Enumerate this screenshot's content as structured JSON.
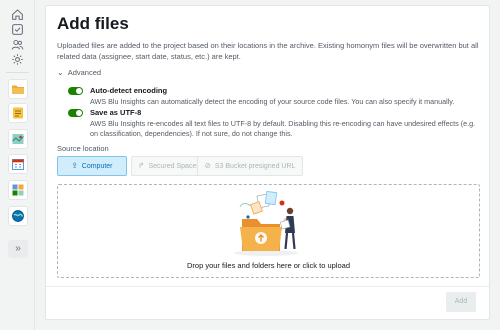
{
  "rail": {
    "icons": [
      "home-icon",
      "checklist-icon",
      "users-icon",
      "gear-icon"
    ],
    "apps": [
      "folder-app-icon",
      "notes-app-icon",
      "map-app-icon",
      "calendar-app-icon",
      "puzzle-app-icon",
      "globe-app-icon"
    ],
    "expand_label": "»"
  },
  "page": {
    "title": "Add files",
    "description": "Uploaded files are added to the project based on their locations in the archive. Existing homonym files will be overwritten but all related data (assignee, start date, status, etc.) are kept."
  },
  "advanced": {
    "label": "Advanced",
    "options": [
      {
        "title": "Auto-detect encoding",
        "description": "AWS Blu Insights can automatically detect the encoding of your source code files. You can also specify it manually.",
        "enabled": true
      },
      {
        "title": "Save as UTF-8",
        "description": "AWS Blu Insights re-encodes all text files to UTF-8 by default. Disabling this re-encoding can have undesired effects (e.g. on classification, dependencies). If not sure, do not change this.",
        "enabled": true
      }
    ]
  },
  "source": {
    "label": "Source location",
    "buttons": [
      {
        "label": "Computer",
        "icon": "upload-icon",
        "active": true
      },
      {
        "label": "Secured Spaces",
        "icon": "share-arrow-icon",
        "active": false
      },
      {
        "label": "S3 Bucket presigned URL",
        "icon": "link-icon",
        "active": false
      }
    ]
  },
  "dropzone": {
    "text": "Drop your files and folders here or click to upload"
  },
  "footer": {
    "add_label": "Add"
  },
  "colors": {
    "toggle_on": "#1d8102",
    "active_source_bg": "#d1ecfb",
    "active_source_text": "#0073bb",
    "folder": "#f0a93b"
  }
}
